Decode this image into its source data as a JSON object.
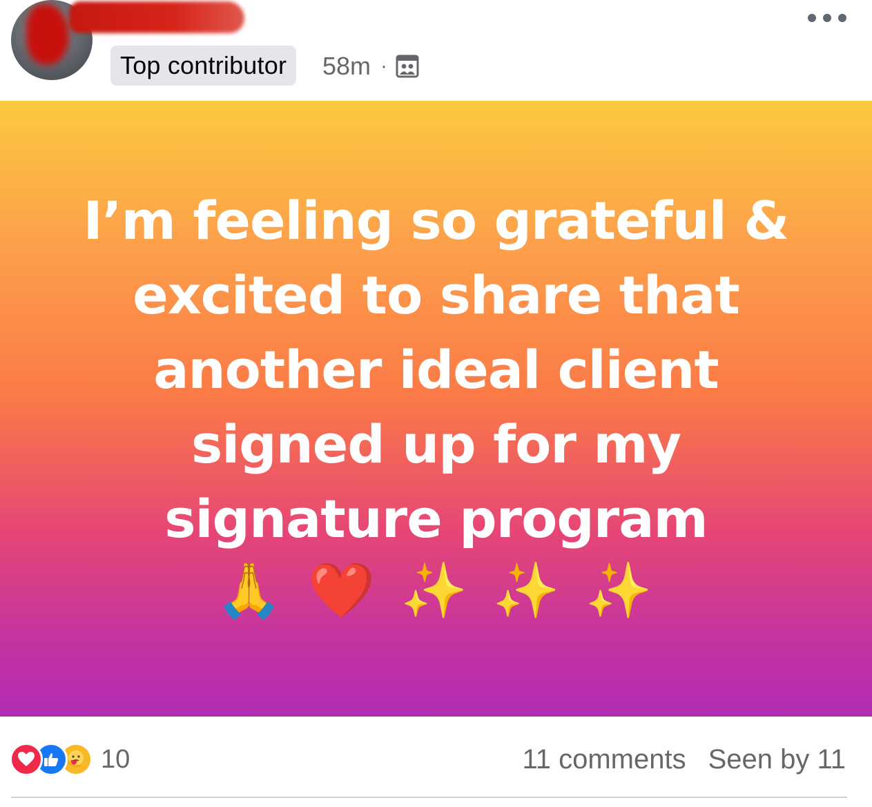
{
  "post": {
    "badge": "Top contributor",
    "time": "58m",
    "separator": "·",
    "audience_icon": "group-members-icon",
    "more_icon": "more-options-icon",
    "text": "I’m feeling so grateful & excited to share that another ideal client signed up for my signature program",
    "emoji": {
      "pray": "🙏",
      "heart": "❤️",
      "sparkles": [
        "✨",
        "✨",
        "✨"
      ]
    },
    "background_gradient": [
      "#fcc93f",
      "#fb7a47",
      "#e64675",
      "#b22bb3"
    ]
  },
  "footer": {
    "reaction_icons": [
      "love-reaction-icon",
      "like-reaction-icon",
      "care-reaction-icon"
    ],
    "reaction_count": "10",
    "comments": "11 comments",
    "seen_by": "Seen by 11"
  },
  "colors": {
    "badge_bg": "#e4e6eb",
    "secondary_text": "#65676b",
    "like_blue": "#1877f2",
    "love_red": "#f0284a",
    "care_yellow": "#f7b928"
  }
}
